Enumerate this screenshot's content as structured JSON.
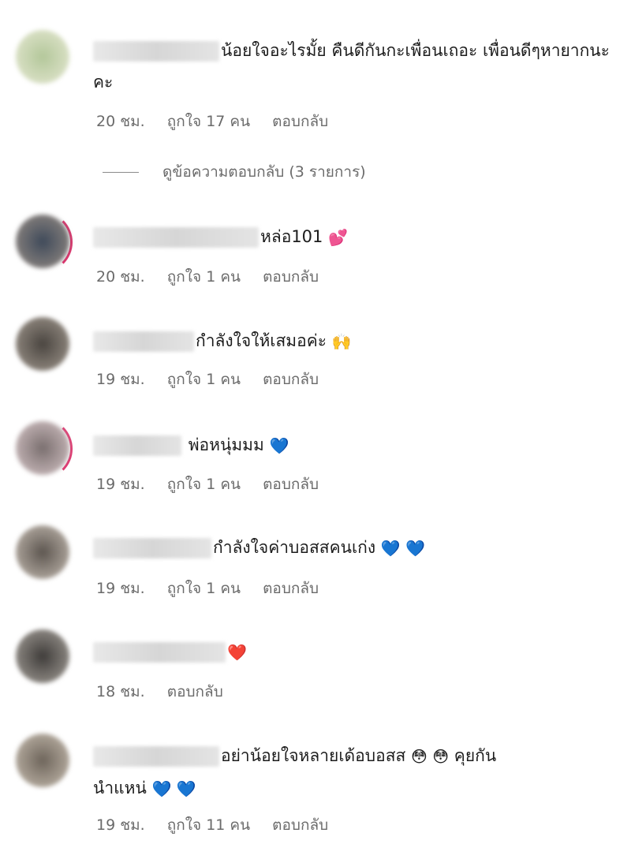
{
  "comments": [
    {
      "text": "น้อยใจอะไรมั้ย คืนดีกันกะเพื่อนเถอะ เพื่อนดีๆหายากนะคะ",
      "time": "20 ชม.",
      "likes": "ถูกใจ 17 คน",
      "reply": "ตอบกลับ"
    },
    {
      "text": "หล่อ101",
      "emoji": "💕",
      "time": "20 ชม.",
      "likes": "ถูกใจ 1 คน",
      "reply": "ตอบกลับ"
    },
    {
      "text": "กำลังใจให้เสมอค่ะ",
      "emoji": "🙌",
      "time": "19 ชม.",
      "likes": "ถูกใจ 1 คน",
      "reply": "ตอบกลับ"
    },
    {
      "text": "พ่อหนุ่มมม",
      "emoji": "💙",
      "time": "19 ชม.",
      "likes": "ถูกใจ 1 คน",
      "reply": "ตอบกลับ"
    },
    {
      "text": "กำลังใจค่าบอสสคนเก่ง",
      "emoji": "💙 💙",
      "time": "19 ชม.",
      "likes": "ถูกใจ 1 คน",
      "reply": "ตอบกลับ"
    },
    {
      "text": "",
      "emoji": "❤️",
      "time": "18 ชม.",
      "reply": "ตอบกลับ"
    },
    {
      "text": "อย่าน้อยใจหลายเด้อบอสส",
      "emoji": "😳 😳",
      "text2": "คุยกัน",
      "line2": "นำแหน่",
      "emoji2": "💙 💙",
      "time": "19 ชม.",
      "likes": "ถูกใจ 11 คน",
      "reply": "ตอบกลับ"
    }
  ],
  "view_replies": "ดูข้อความตอบกลับ (3 รายการ)"
}
